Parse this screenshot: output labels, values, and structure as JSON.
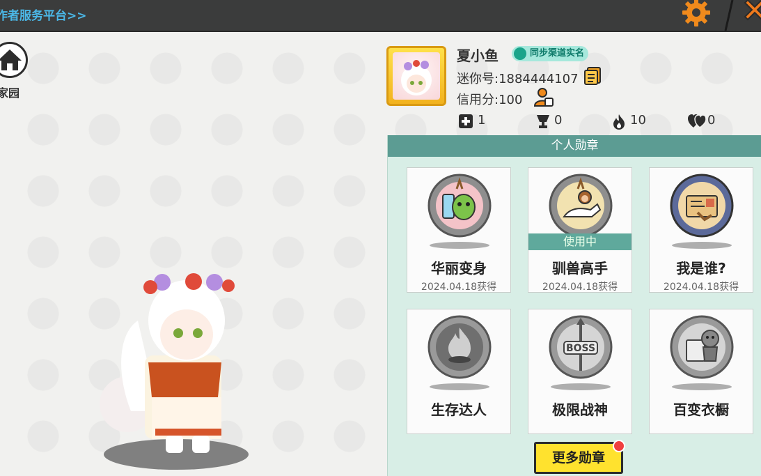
{
  "topbar": {
    "link_text": "作者服务平台>>"
  },
  "home": {
    "label": "家园"
  },
  "profile": {
    "name": "夏小鱼",
    "verify_badge": "同步渠道实名",
    "mini_id": "迷你号:1884444107",
    "credit": "信用分:100"
  },
  "stats": [
    {
      "icon": "plus-square-icon",
      "value": "1"
    },
    {
      "icon": "trophy-icon",
      "value": "0"
    },
    {
      "icon": "flame-icon",
      "value": "10"
    },
    {
      "icon": "hearts-icon",
      "value": "0"
    }
  ],
  "medals": {
    "header": "个人勋章",
    "items": [
      {
        "title": "华丽变身",
        "date": "2024.04.18获得",
        "in_use": ""
      },
      {
        "title": "驯兽高手",
        "date": "2024.04.18获得",
        "in_use": "使用中"
      },
      {
        "title": "我是谁?",
        "date": "2024.04.18获得",
        "in_use": ""
      },
      {
        "title": "生存达人",
        "date": "",
        "in_use": ""
      },
      {
        "title": "极限战神",
        "date": "",
        "in_use": ""
      },
      {
        "title": "百变衣橱",
        "date": "",
        "in_use": ""
      }
    ],
    "boss_text": "BOSS",
    "more_button": "更多勋章"
  },
  "colors": {
    "accent_teal": "#5c9c93",
    "button_yellow": "#ffe22e",
    "link_blue": "#4bb8e8",
    "gear_orange": "#f08a1c"
  }
}
